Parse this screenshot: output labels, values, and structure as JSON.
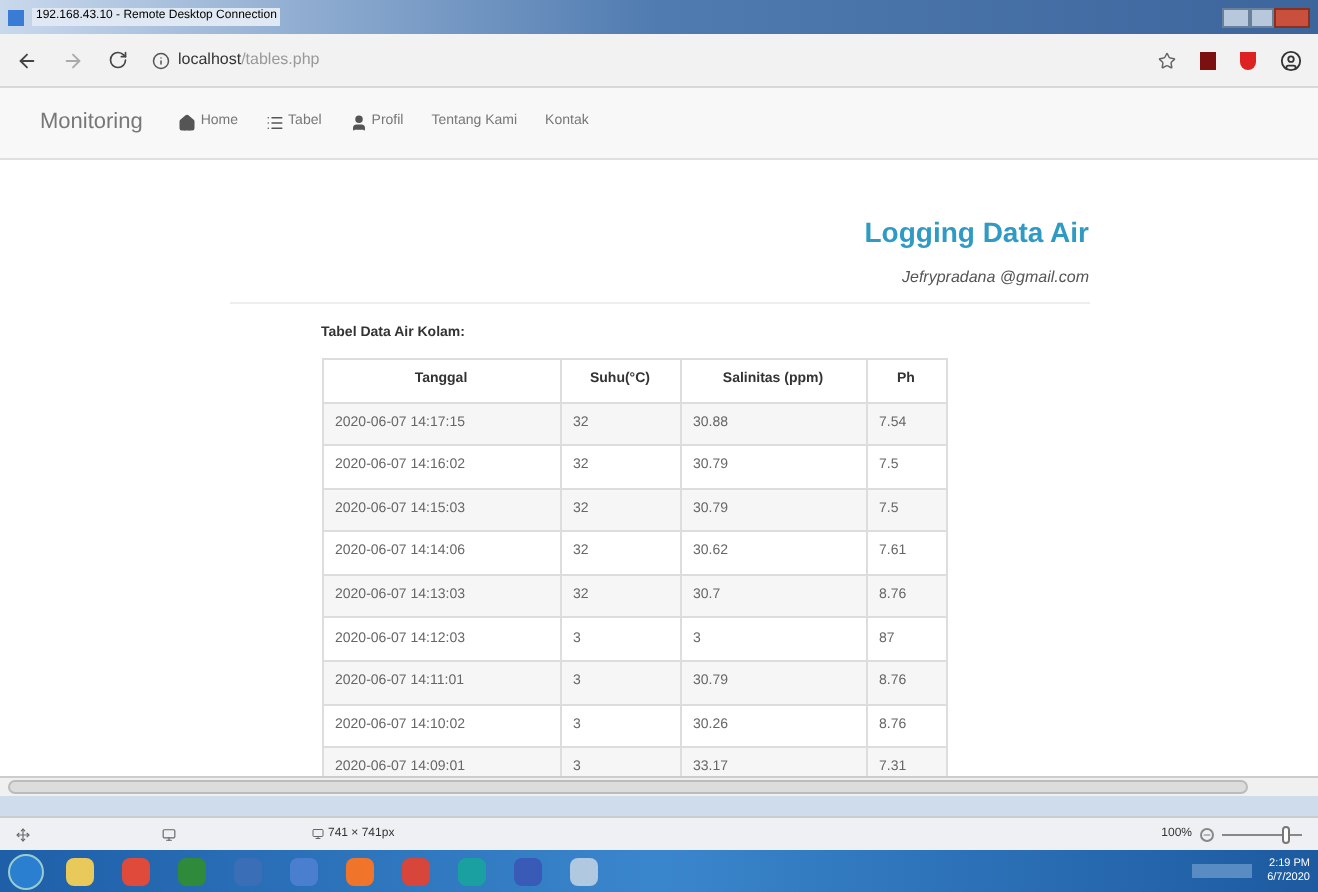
{
  "window": {
    "title": "192.168.43.10 - Remote Desktop Connection"
  },
  "browser": {
    "url_host": "localhost",
    "url_path": "/tables.php"
  },
  "navbar": {
    "brand": "Monitoring",
    "items": [
      {
        "label": "Home",
        "kind": "home"
      },
      {
        "label": "Tabel",
        "kind": "list"
      },
      {
        "label": "Profil",
        "kind": "user"
      },
      {
        "label": "Tentang Kami",
        "kind": "plain"
      },
      {
        "label": "Kontak",
        "kind": "plain"
      }
    ]
  },
  "header": {
    "title": "Logging Data Air",
    "email": "Jefrypradana @gmail.com"
  },
  "table": {
    "caption": "Tabel Data Air Kolam:",
    "columns": [
      "Tanggal",
      "Suhu(°C)",
      "Salinitas (ppm)",
      "Ph"
    ],
    "rows": [
      [
        "2020-06-07 14:17:15",
        "32",
        "30.88",
        "7.54"
      ],
      [
        "2020-06-07 14:16:02",
        "32",
        "30.79",
        "7.5"
      ],
      [
        "2020-06-07 14:15:03",
        "32",
        "30.79",
        "7.5"
      ],
      [
        "2020-06-07 14:14:06",
        "32",
        "30.62",
        "7.61"
      ],
      [
        "2020-06-07 14:13:03",
        "32",
        "30.7",
        "8.76"
      ],
      [
        "2020-06-07 14:12:03",
        "3",
        "3",
        "87"
      ],
      [
        "2020-06-07 14:11:01",
        "3",
        "30.79",
        "8.76"
      ],
      [
        "2020-06-07 14:10:02",
        "3",
        "30.26",
        "8.76"
      ],
      [
        "2020-06-07 14:09:01",
        "3",
        "33.17",
        "7.31"
      ]
    ]
  },
  "status_bar": {
    "size": "741 × 741px",
    "zoom": "100%",
    "zoom_slider": {
      "level": 0.8
    }
  },
  "taskbar": {
    "time": "2:19 PM",
    "date": "6/7/2020"
  }
}
